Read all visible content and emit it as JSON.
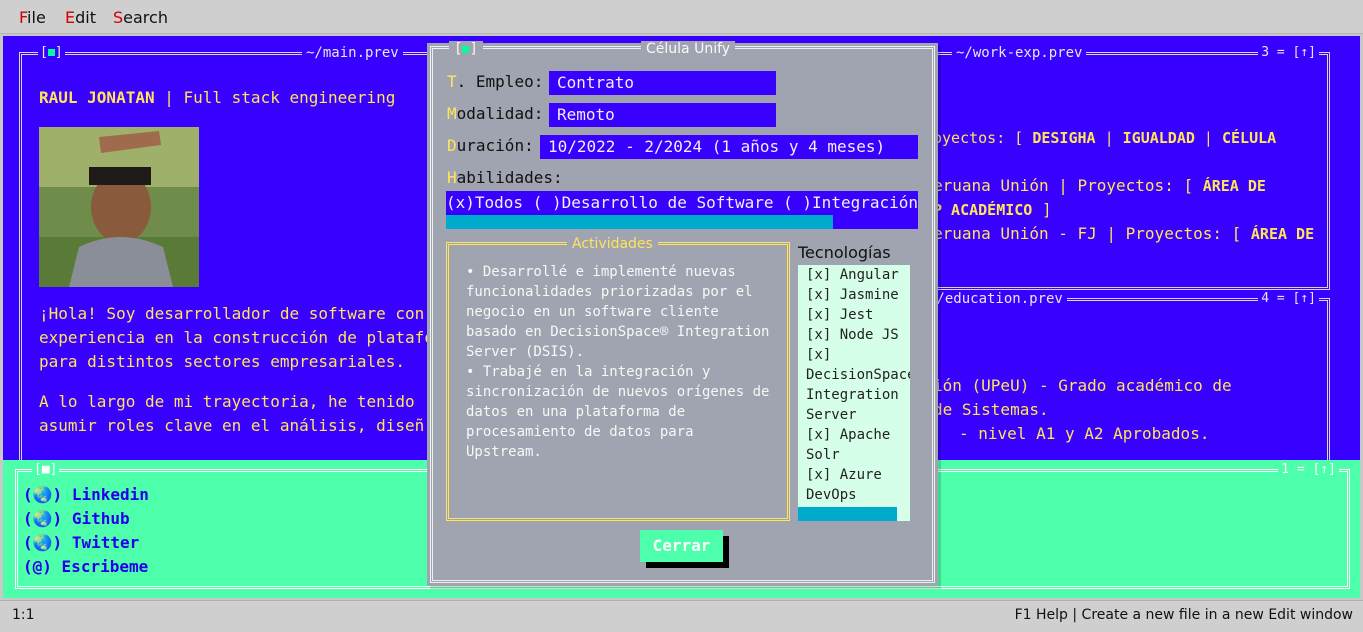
{
  "menu": {
    "file": "File",
    "edit": "Edit",
    "search": "Search"
  },
  "windows": {
    "main": {
      "title": "~/main.prev",
      "dot": "[■]"
    },
    "work": {
      "title": "~/work-exp.prev",
      "num": "3 = [↑]"
    },
    "education": {
      "title": "~/education.prev",
      "num": "4 = [↑]"
    },
    "links": {
      "dot": "[■]",
      "num": "1 = [↑]"
    }
  },
  "profile": {
    "name": "RAUL JONATAN",
    "role": "| Full stack engineering",
    "bio1": "¡Hola! Soy desarrollador de software con",
    "bio2": "experiencia en la construcción de platafo",
    "bio3": "para distintos sectores empresariales.",
    "bio4": "A lo largo de mi trayectoria, he tenido",
    "bio5": "asumir roles clave en el análisis, diseñ"
  },
  "work": {
    "line1_pre": "oyectos: [ ",
    "line1_p1": "DESIGHA",
    "line1_sep1": " | ",
    "line1_p2": "IGUALDAD",
    "line1_sep2": " | ",
    "line1_p3": "CÉLULA",
    "line2_pre": "eruana Unión | Proyectos: [ ",
    "line2_p": "ÁREA DE",
    "line3_p": "P ACADÉMICO",
    "line3_end": "  ]",
    "line4_pre": "eruana Unión - FJ | Proyectos: [ ",
    "line4_p": "ÁREA DE"
  },
  "education": {
    "line1": "ión (UPeU) - Grado académico de",
    "line2": "de Sistemas.",
    "line3": "- nivel A1 y A2 Aprobados."
  },
  "links": [
    {
      "icon": "(🌏)",
      "label": "Linkedin"
    },
    {
      "icon": "(🌏)",
      "label": "Github"
    },
    {
      "icon": "(🌏)",
      "label": "Twitter"
    },
    {
      "icon": "(@)",
      "label": "Escribeme"
    }
  ],
  "status": {
    "position": "1:1",
    "help": "F1 Help | Create a new file in a new Edit window"
  },
  "dialog": {
    "title": "Célula Unify",
    "dot": "[■]",
    "empleo_label_hk": "T",
    "empleo_label_rest": ". Empleo:",
    "empleo_value": "Contrato",
    "modalidad_label_hk": "M",
    "modalidad_label_rest": "odalidad:",
    "modalidad_value": "Remoto",
    "duracion_label_hk": "D",
    "duracion_label_rest": "uración:",
    "duracion_value": "10/2022 - 2/2024 (1 años y 4 meses)",
    "habilidades_label_hk": "H",
    "habilidades_label_rest": "abilidades:",
    "habilidades_value": "(x)Todos ( )Desarrollo de Software ( )Integración",
    "habilidades_scroll": 0.82,
    "actividades_title": "Actividades",
    "actividades": [
      "• Desarrollé e implementé nuevas",
      "funcionalidades priorizadas por el",
      "negocio en un software cliente",
      "basado en DecisionSpace® Integration",
      "Server (DSIS).",
      "• Trabajé en la integración y",
      "sincronización de nuevos orígenes de",
      "datos en una plataforma de",
      "procesamiento de datos para",
      "Upstream."
    ],
    "tecnologias_title": "Tecnologías",
    "tecnologias": [
      "[x] Angular",
      "[x] Jasmine",
      "[x] Jest",
      "[x] Node JS",
      "[x]",
      "DecisionSpace",
      "Integration",
      "Server",
      "[x] Apache",
      "Solr",
      "[x] Azure",
      "DevOps"
    ],
    "tecnologias_scroll": 0.88,
    "close_label": "Cerrar"
  },
  "colors": {
    "blue": "#3700ff",
    "green": "#4dffaa",
    "yellow": "#ffe45c",
    "gray": "#a0a3b0"
  }
}
